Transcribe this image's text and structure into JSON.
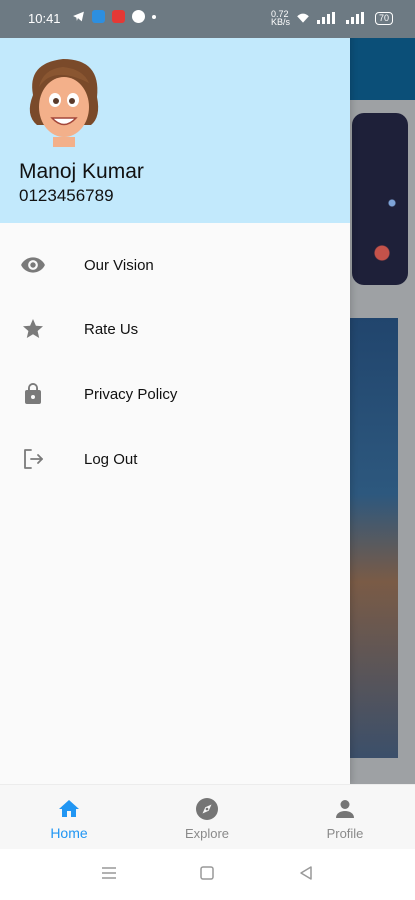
{
  "status_bar": {
    "time": "10:41",
    "network_speed": "0.72\nKB/s",
    "battery": "70"
  },
  "drawer": {
    "user": {
      "name": "Manoj Kumar",
      "phone": "0123456789"
    },
    "menu": [
      {
        "label": "Our Vision",
        "icon": "eye-icon"
      },
      {
        "label": "Rate Us",
        "icon": "star-icon"
      },
      {
        "label": "Privacy Policy",
        "icon": "lock-icon"
      },
      {
        "label": "Log Out",
        "icon": "logout-icon"
      }
    ]
  },
  "bottom_nav": [
    {
      "label": "Home",
      "icon": "home-icon",
      "active": true
    },
    {
      "label": "Explore",
      "icon": "compass-icon",
      "active": false
    },
    {
      "label": "Profile",
      "icon": "person-icon",
      "active": false
    }
  ],
  "colors": {
    "header_bg": "#c2e9fc",
    "accent": "#2196f3",
    "icon_gray": "#7a7a7a"
  }
}
